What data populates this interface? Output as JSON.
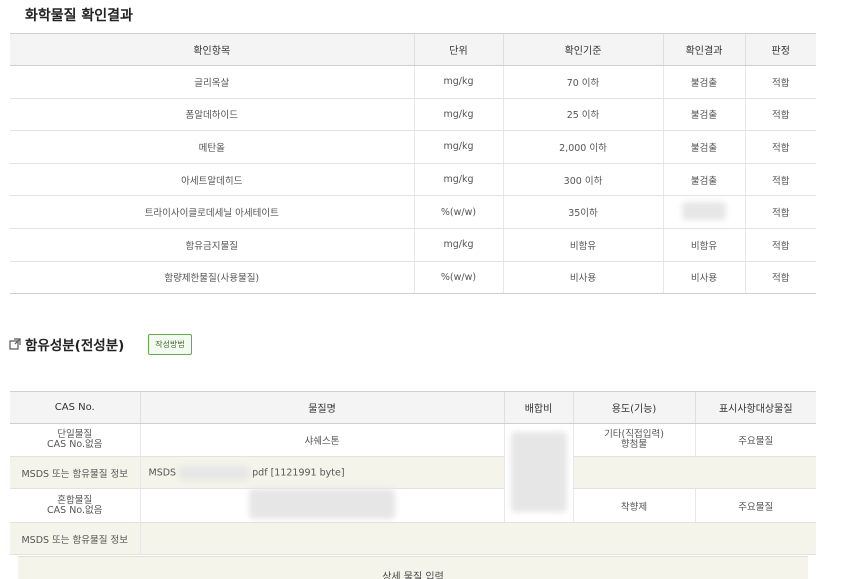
{
  "section1": {
    "title": "화학물질 확인결과",
    "headers": [
      "확인항목",
      "단위",
      "확인기준",
      "확인결과",
      "판정"
    ],
    "rows": [
      {
        "item": "글리옥살",
        "unit": "mg/kg",
        "standard": "70 이하",
        "result": "불검출",
        "verdict": "적합"
      },
      {
        "item": "폼알데하이드",
        "unit": "mg/kg",
        "standard": "25 이하",
        "result": "불검출",
        "verdict": "적합"
      },
      {
        "item": "메탄올",
        "unit": "mg/kg",
        "standard": "2,000 이하",
        "result": "불검출",
        "verdict": "적합"
      },
      {
        "item": "아세트알데히드",
        "unit": "mg/kg",
        "standard": "300 이하",
        "result": "불검출",
        "verdict": "적합"
      },
      {
        "item": "트라이사이클로데세닐 아세테이트",
        "unit": "%(w/w)",
        "standard": "35이하",
        "result": "",
        "verdict": "적합"
      },
      {
        "item": "함유금지물질",
        "unit": "mg/kg",
        "standard": "비함유",
        "result": "비함유",
        "verdict": "적합"
      },
      {
        "item": "함량제한물질(사용물질)",
        "unit": "%(w/w)",
        "standard": "비사용",
        "result": "비사용",
        "verdict": "적합"
      }
    ]
  },
  "section2": {
    "title": "함유성분(전성분)",
    "write_button": "작성방법",
    "headers": [
      "CAS No.",
      "물질명",
      "배합비",
      "용도(기능)",
      "표시사항대상물질"
    ],
    "substance1": {
      "type": "단일물질",
      "cas": "CAS No.없음",
      "name": "샤쉐스톤",
      "usage_line1": "기타(직접입력)",
      "usage_line2": "향첨물",
      "label_target": "주요물질"
    },
    "msds1": {
      "label": "MSDS 또는 함유물질 정보",
      "prefix": "MSDS",
      "suffix": "pdf [1121991 byte]"
    },
    "substance2": {
      "type": "혼합물질",
      "cas": "CAS No.없음",
      "name": "",
      "usage": "착향제",
      "label_target": "주요물질"
    },
    "msds2": {
      "label": "MSDS 또는 함유물질 정보"
    },
    "detail_button": "상세 물질 입력"
  }
}
